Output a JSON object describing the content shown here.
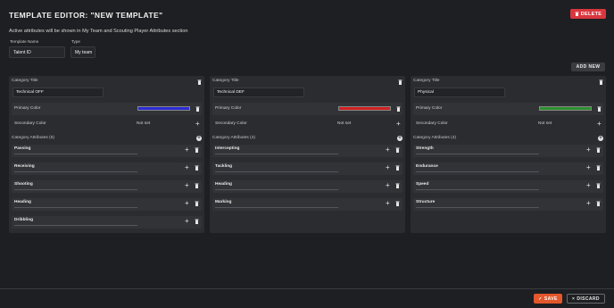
{
  "header": {
    "title": "TEMPLATE EDITOR: \"NEW TEMPLATE\"",
    "delete_label": "DELETE"
  },
  "notice": "Active attributes will be shown in My Team and Scouting Player Attributes section",
  "form": {
    "template_name_label": "Template Name",
    "template_name_value": "Talent ID",
    "type_label": "Type",
    "type_value": "My team"
  },
  "add_new_label": "ADD NEW",
  "panels": [
    {
      "category_title_label": "Category Title",
      "category_title_value": "Technical OFF",
      "primary_color_label": "Primary Color",
      "primary_color": "#2b2bd6",
      "secondary_color_label": "Secondary Color",
      "secondary_color_value": "Not set",
      "attributes_label": "Category Attributes (5)",
      "attributes": [
        "Passing",
        "Receiving",
        "Shooting",
        "Heading",
        "Dribbling"
      ]
    },
    {
      "category_title_label": "Category Title",
      "category_title_value": "Technical DEF",
      "primary_color_label": "Primary Color",
      "primary_color": "#d11f1f",
      "secondary_color_label": "Secondary Color",
      "secondary_color_value": "Not set",
      "attributes_label": "Category Attributes (4)",
      "attributes": [
        "Intercepting",
        "Tackling",
        "Heading",
        "Marking"
      ]
    },
    {
      "category_title_label": "Category Title",
      "category_title_value": "Physical",
      "primary_color_label": "Primary Color",
      "primary_color": "#2d8f2d",
      "secondary_color_label": "Secondary Color",
      "secondary_color_value": "Not set",
      "attributes_label": "Category Attributes (4)",
      "attributes": [
        "Strength",
        "Endurance",
        "Speed",
        "Structure"
      ]
    }
  ],
  "footer": {
    "save_label": "SAVE",
    "discard_label": "DISCARD"
  },
  "colors": {
    "background": "#1e1f22",
    "panel": "#2b2c30",
    "delete": "#d9363e",
    "save": "#e2572b"
  }
}
